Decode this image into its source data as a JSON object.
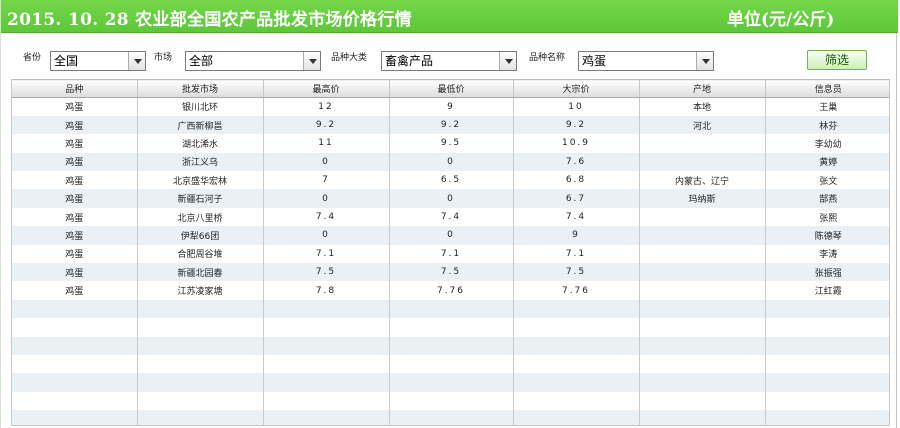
{
  "header": {
    "title": "2015. 10. 28  农业部全国农产品批发市场价格行情",
    "unit": "单位(元/公斤)",
    "accent_color": "#63c93f"
  },
  "filters": {
    "province_label": "省份",
    "province_value": "全国",
    "market_label": "市场",
    "market_value": "全部",
    "category_label": "品种大类",
    "category_value": "畜禽产品",
    "variety_label": "品种名称",
    "variety_value": "鸡蛋",
    "filter_button": "筛选"
  },
  "table": {
    "columns": [
      "品种",
      "批发市场",
      "最高价",
      "最低价",
      "大宗价",
      "产地",
      "信息员"
    ],
    "rows": [
      [
        "鸡蛋",
        "银川北环",
        "12",
        "9",
        "10",
        "本地",
        "王巢"
      ],
      [
        "鸡蛋",
        "广西新柳邕",
        "9.2",
        "9.2",
        "9.2",
        "河北",
        "林芬"
      ],
      [
        "鸡蛋",
        "湖北浠水",
        "11",
        "9.5",
        "10.9",
        "",
        "李幼幼"
      ],
      [
        "鸡蛋",
        "浙江义乌",
        "0",
        "0",
        "7.6",
        "",
        "黄婷"
      ],
      [
        "鸡蛋",
        "北京盛华宏林",
        "7",
        "6.5",
        "6.8",
        "内蒙古、辽宁",
        "张文"
      ],
      [
        "鸡蛋",
        "新疆石河子",
        "0",
        "0",
        "6.7",
        "玛纳斯",
        "郜燕"
      ],
      [
        "鸡蛋",
        "北京八里桥",
        "7.4",
        "7.4",
        "7.4",
        "",
        "张熙"
      ],
      [
        "鸡蛋",
        "伊犁66团",
        "0",
        "0",
        "9",
        "",
        "陈德琴"
      ],
      [
        "鸡蛋",
        "合肥周谷堆",
        "7.1",
        "7.1",
        "7.1",
        "",
        "李涛"
      ],
      [
        "鸡蛋",
        "新疆北园春",
        "7.5",
        "7.5",
        "7.5",
        "",
        "张振强"
      ],
      [
        "鸡蛋",
        "江苏凌家塘",
        "7.8",
        "7.76",
        "7.76",
        "",
        "江红霞"
      ]
    ],
    "empty_rows": 7
  }
}
